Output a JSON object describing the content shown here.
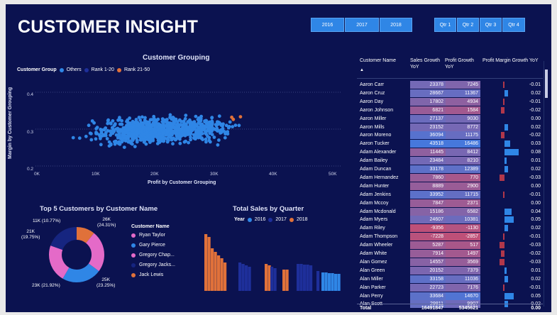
{
  "title": "CUSTOMER INSIGHT",
  "years": [
    "2016",
    "2017",
    "2018"
  ],
  "quarters": [
    "Qtr 1",
    "Qtr 2",
    "Qtr 3",
    "Qtr 4"
  ],
  "colors": {
    "background": "#0b1250",
    "button": "#2f86e6",
    "others": "#2f86e6",
    "rank1_20": "#1e2f9a",
    "rank21_50": "#e0713a",
    "pink": "#e46ac8",
    "navy": "#162580"
  },
  "scatter": {
    "title": "Customer Grouping",
    "legend_title": "Customer Group",
    "legend": [
      "Others",
      "Rank 1-20",
      "Rank 21-50"
    ],
    "y_axis_title": "Margin by Customer Grouping",
    "x_axis_title": "Profit by Customer Grouping",
    "y_ticks": [
      "0.4",
      "0.3",
      "0.2"
    ],
    "x_ticks": [
      "0K",
      "10K",
      "20K",
      "30K",
      "40K",
      "50K"
    ]
  },
  "donut": {
    "title": "Top 5 Customers by Customer Name",
    "legend_title": "Customer Name",
    "legend": [
      "Ryan Taylor",
      "Gary Pierce",
      "Gregory Chap...",
      "Gregory Jacks...",
      "Jack Lewis"
    ],
    "labels": {
      "l26": "26K",
      "l26p": "(24.31%)",
      "l25": "25K",
      "l25p": "(23.25%)",
      "l23": "23K (21.92%)",
      "l21": "21K",
      "l21p": "(19.75%)",
      "l11": "11K (10.77%)"
    }
  },
  "bars": {
    "title": "Total Sales by Quarter",
    "legend_title": "Year",
    "legend": [
      "2016",
      "2017",
      "2018"
    ]
  },
  "table": {
    "headers": [
      "Customer Name",
      "Sales Growth YoY",
      "Profit Growth YoY",
      "Profit Margin Growth YoY"
    ],
    "rows": [
      [
        "Aaron Carr",
        "23378",
        "7245",
        "-0.01"
      ],
      [
        "Aaron Cruz",
        "28667",
        "11367",
        "0.02"
      ],
      [
        "Aaron Day",
        "17802",
        "4934",
        "-0.01"
      ],
      [
        "Aaron Johnson",
        "6821",
        "1584",
        "-0.02"
      ],
      [
        "Aaron Miller",
        "27137",
        "9030",
        "0.00"
      ],
      [
        "Aaron Mills",
        "23152",
        "8772",
        "0.02"
      ],
      [
        "Aaron Moreno",
        "36094",
        "11175",
        "-0.02"
      ],
      [
        "Aaron Tucker",
        "43518",
        "16486",
        "0.03"
      ],
      [
        "Adam Alexander",
        "11445",
        "8412",
        "0.08"
      ],
      [
        "Adam Bailey",
        "23484",
        "8210",
        "0.01"
      ],
      [
        "Adam Duncan",
        "33178",
        "12389",
        "0.02"
      ],
      [
        "Adam Hernandez",
        "7860",
        "770",
        "-0.03"
      ],
      [
        "Adam Hunter",
        "8889",
        "2900",
        "0.00"
      ],
      [
        "Adam Jenkins",
        "33952",
        "11715",
        "-0.01"
      ],
      [
        "Adam Mccoy",
        "7847",
        "2371",
        "0.00"
      ],
      [
        "Adam Mcdonald",
        "15186",
        "6582",
        "0.04"
      ],
      [
        "Adam Myers",
        "24607",
        "10381",
        "0.05"
      ],
      [
        "Adam Riley",
        "-9356",
        "-1130",
        "0.02"
      ],
      [
        "Adam Thompson",
        "-7228",
        "-2857",
        "-0.01"
      ],
      [
        "Adam Wheeler",
        "5287",
        "517",
        "-0.03"
      ],
      [
        "Adam White",
        "7914",
        "1497",
        "-0.02"
      ],
      [
        "Alan Gomez",
        "14557",
        "3569",
        "-0.03"
      ],
      [
        "Alan Green",
        "20152",
        "7379",
        "0.01"
      ],
      [
        "Alan Miller",
        "33158",
        "11036",
        "0.02"
      ],
      [
        "Alan Parker",
        "22723",
        "7176",
        "-0.01"
      ],
      [
        "Alan Perry",
        "33684",
        "14670",
        "0.05"
      ],
      [
        "Alan Scott",
        "29811",
        "9907",
        "0.02"
      ]
    ],
    "total": [
      "Total",
      "16491847",
      "5345621",
      "0.00"
    ]
  }
}
